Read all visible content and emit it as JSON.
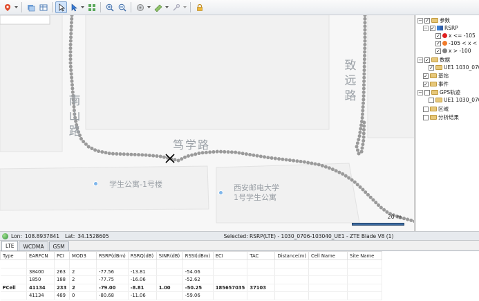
{
  "toolbar": {
    "buttons": [
      "map-pin",
      "layers",
      "table-view",
      "pointer",
      "select",
      "grid",
      "zoom-in",
      "zoom-out",
      "pan",
      "measure",
      "tools",
      "lock"
    ]
  },
  "map": {
    "roads": {
      "nanshan": "南山路",
      "zhiyuan": "致远路",
      "duxue": "笃学路"
    },
    "pois": {
      "dorm1": "学生公寓-1号楼",
      "xupt_line1": "西安邮电大学",
      "xupt_line2": "1号学生公寓"
    },
    "scale_label": "20 m",
    "colors": {
      "trace": "#9a9a9a",
      "road_label": "#9aa0a6",
      "poi_dot": "#7fb6ea"
    }
  },
  "tree": {
    "items": [
      {
        "label": "参数",
        "kind": "folder"
      },
      {
        "label": "RSRP",
        "kind": "param"
      },
      {
        "label": "x <= -105",
        "kind": "legend",
        "color": "#e02020"
      },
      {
        "label": "-105 < x <",
        "kind": "legend",
        "color": "#f07a2a"
      },
      {
        "label": "x > -100",
        "kind": "legend",
        "color": "#808080"
      },
      {
        "label": "数据",
        "kind": "folder"
      },
      {
        "label": "UE1 1030_0706",
        "kind": "file"
      },
      {
        "label": "基站",
        "kind": "folder"
      },
      {
        "label": "事件",
        "kind": "folder"
      },
      {
        "label": "GPS轨迹",
        "kind": "folder"
      },
      {
        "label": "UE1 1030_070",
        "kind": "file"
      },
      {
        "label": "区域",
        "kind": "folder"
      },
      {
        "label": "分析结果",
        "kind": "folder"
      }
    ]
  },
  "status": {
    "lon_label": "Lon:",
    "lon_value": "108.8937841",
    "lat_label": "Lat:",
    "lat_value": "34.1528605",
    "selected": "Selected: RSRP(LTE) - 1030_0706-103040_UE1 - ZTE Blade V8 (1)"
  },
  "tabs": [
    "LTE",
    "WCDMA",
    "GSM"
  ],
  "table": {
    "headers": [
      "Type",
      "EARFCN",
      "PCI",
      "MOD3",
      "RSRP(dBm)",
      "RSRQ(dB)",
      "SINR(dB)",
      "RSSI(dBm)",
      "ECI",
      "TAC",
      "Distance(m)",
      "Cell Name",
      "Site Name"
    ],
    "rows": [
      [
        "",
        "",
        "",
        "",
        "",
        "",
        "",
        "",
        "",
        "",
        "",
        "",
        ""
      ],
      [
        "",
        "38400",
        "263",
        "2",
        "-77.56",
        "-13.81",
        "",
        "-54.06",
        "",
        "",
        "",
        "",
        ""
      ],
      [
        "",
        "1850",
        "188",
        "2",
        "-77.75",
        "-16.06",
        "",
        "-52.62",
        "",
        "",
        "",
        "",
        ""
      ],
      [
        "PCell",
        "41134",
        "233",
        "2",
        "-79.00",
        "-8.81",
        "1.00",
        "-50.25",
        "185657035",
        "37103",
        "",
        "",
        ""
      ],
      [
        "",
        "41134",
        "489",
        "0",
        "-80.68",
        "-11.06",
        "",
        "-59.06",
        "",
        "",
        "",
        "",
        ""
      ]
    ]
  }
}
